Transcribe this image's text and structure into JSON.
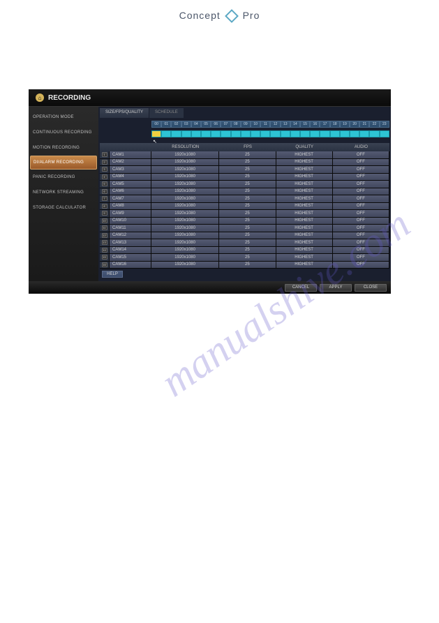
{
  "brand": {
    "left": "Concept",
    "right": "Pro"
  },
  "watermark": "manualshive.com",
  "panel_title": "RECORDING",
  "sidebar": {
    "items": [
      {
        "label": "OPERATION MODE"
      },
      {
        "label": "CONTINUOUS RECORDING"
      },
      {
        "label": "MOTION RECORDING"
      },
      {
        "label": "DI/ALARM RECORDING"
      },
      {
        "label": "PANIC RECORDING"
      },
      {
        "label": "NETWORK STREAMING"
      },
      {
        "label": "STORAGE CALCULATOR"
      }
    ],
    "active_index": 3
  },
  "tabs": [
    {
      "label": "SIZE/FPS/QUALITY",
      "active": true
    },
    {
      "label": "SCHEDULE",
      "active": false
    }
  ],
  "timeline_hours": [
    "00",
    "01",
    "02",
    "03",
    "04",
    "05",
    "06",
    "07",
    "08",
    "09",
    "10",
    "11",
    "12",
    "13",
    "14",
    "15",
    "16",
    "17",
    "18",
    "19",
    "20",
    "21",
    "22",
    "23"
  ],
  "table": {
    "headers": {
      "resolution": "RESOLUTION",
      "fps": "FPS",
      "quality": "QUALITY",
      "audio": "AUDIO"
    },
    "rows": [
      {
        "idx": "1",
        "name": "CAM1",
        "resolution": "1920x1080",
        "fps": "25",
        "quality": "HIGHEST",
        "audio": "OFF"
      },
      {
        "idx": "2",
        "name": "CAM2",
        "resolution": "1920x1080",
        "fps": "25",
        "quality": "HIGHEST",
        "audio": "OFF"
      },
      {
        "idx": "3",
        "name": "CAM3",
        "resolution": "1920x1080",
        "fps": "25",
        "quality": "HIGHEST",
        "audio": "OFF"
      },
      {
        "idx": "4",
        "name": "CAM4",
        "resolution": "1920x1080",
        "fps": "25",
        "quality": "HIGHEST",
        "audio": "OFF"
      },
      {
        "idx": "5",
        "name": "CAM5",
        "resolution": "1920x1080",
        "fps": "25",
        "quality": "HIGHEST",
        "audio": "OFF"
      },
      {
        "idx": "6",
        "name": "CAM6",
        "resolution": "1920x1080",
        "fps": "25",
        "quality": "HIGHEST",
        "audio": "OFF"
      },
      {
        "idx": "7",
        "name": "CAM7",
        "resolution": "1920x1080",
        "fps": "25",
        "quality": "HIGHEST",
        "audio": "OFF"
      },
      {
        "idx": "8",
        "name": "CAM8",
        "resolution": "1920x1080",
        "fps": "25",
        "quality": "HIGHEST",
        "audio": "OFF"
      },
      {
        "idx": "9",
        "name": "CAM9",
        "resolution": "1920x1080",
        "fps": "25",
        "quality": "HIGHEST",
        "audio": "OFF"
      },
      {
        "idx": "10",
        "name": "CAM10",
        "resolution": "1920x1080",
        "fps": "25",
        "quality": "HIGHEST",
        "audio": "OFF"
      },
      {
        "idx": "11",
        "name": "CAM11",
        "resolution": "1920x1080",
        "fps": "25",
        "quality": "HIGHEST",
        "audio": "OFF"
      },
      {
        "idx": "12",
        "name": "CAM12",
        "resolution": "1920x1080",
        "fps": "25",
        "quality": "HIGHEST",
        "audio": "OFF"
      },
      {
        "idx": "13",
        "name": "CAM13",
        "resolution": "1920x1080",
        "fps": "25",
        "quality": "HIGHEST",
        "audio": "OFF"
      },
      {
        "idx": "14",
        "name": "CAM14",
        "resolution": "1920x1080",
        "fps": "25",
        "quality": "HIGHEST",
        "audio": "OFF"
      },
      {
        "idx": "15",
        "name": "CAM15",
        "resolution": "1920x1080",
        "fps": "25",
        "quality": "HIGHEST",
        "audio": "OFF"
      },
      {
        "idx": "16",
        "name": "CAM16",
        "resolution": "1920x1080",
        "fps": "25",
        "quality": "HIGHEST",
        "audio": "OFF"
      }
    ]
  },
  "help_label": "HELP",
  "footer": {
    "cancel": "CANCEL",
    "apply": "APPLY",
    "close": "CLOSE"
  }
}
